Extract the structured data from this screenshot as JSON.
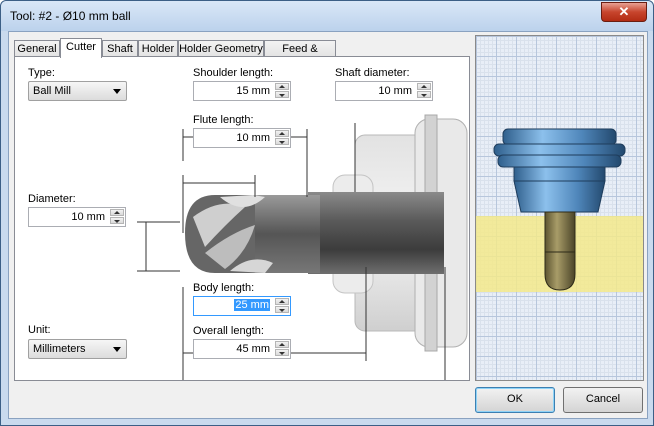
{
  "window": {
    "title": "Tool: #2 - Ø10 mm ball",
    "close_glyph": "✕"
  },
  "tabs": [
    {
      "label": "General"
    },
    {
      "label": "Cutter"
    },
    {
      "label": "Shaft"
    },
    {
      "label": "Holder"
    },
    {
      "label": "Holder Geometry"
    },
    {
      "label": "Feed & Speed"
    }
  ],
  "active_tab": "Cutter",
  "form": {
    "type_label": "Type:",
    "type_value": "Ball Mill",
    "shoulder_length_label": "Shoulder length:",
    "shoulder_length_value": "15 mm",
    "shaft_diameter_label": "Shaft diameter:",
    "shaft_diameter_value": "10 mm",
    "flute_length_label": "Flute length:",
    "flute_length_value": "10 mm",
    "diameter_label": "Diameter:",
    "diameter_value": "10 mm",
    "body_length_label": "Body length:",
    "body_length_value": "25 mm",
    "overall_length_label": "Overall length:",
    "overall_length_value": "45 mm",
    "unit_label": "Unit:",
    "unit_value": "Millimeters"
  },
  "buttons": {
    "ok": "OK",
    "cancel": "Cancel"
  },
  "colors": {
    "accent": "#3399ff",
    "stock": "#f0e68c",
    "tool_blue": "#5a8fc0"
  }
}
